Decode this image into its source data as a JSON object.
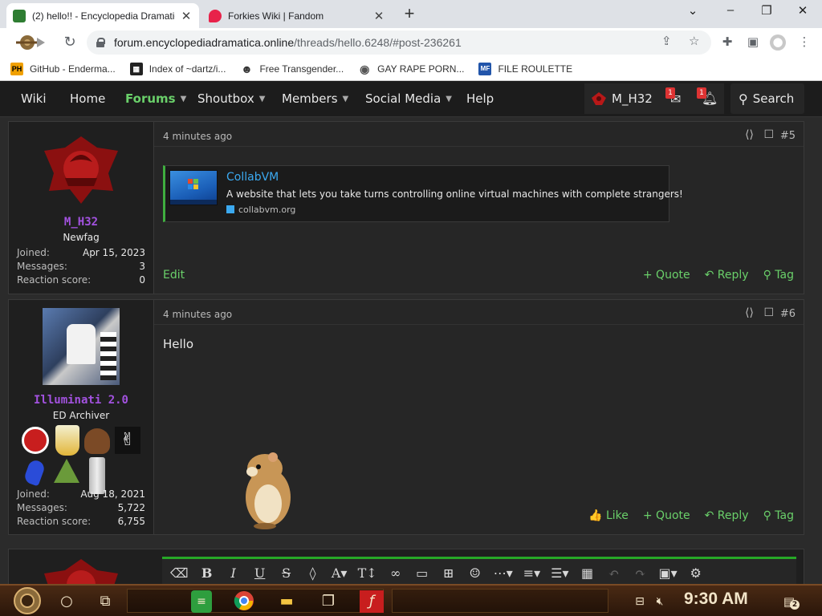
{
  "browser": {
    "tabs": [
      {
        "title": "(2) hello!! - Encyclopedia Dramatica",
        "close": "✕",
        "favicon_color": "#2e7d32"
      },
      {
        "title": "Forkies Wiki | Fandom",
        "close": "✕",
        "favicon_color": "#e8224a"
      }
    ],
    "new_tab": "+",
    "window_controls": {
      "minimize": "⌄",
      "restore": "–",
      "maximize": "❐",
      "close": "✕"
    },
    "nav": {
      "back": "←",
      "forward": "→",
      "reload": "↻"
    },
    "url_host": "forum.encyclopediadramatica.online",
    "url_path": "/threads/hello.6248/#post-236261",
    "bookmarks": [
      {
        "label": "GitHub - Enderma...",
        "icon": "PH",
        "icon_bg": "#f0a000"
      },
      {
        "label": "Index of ~dartz/i...",
        "icon": "▦",
        "icon_bg": "#222222"
      },
      {
        "label": "Free Transgender...",
        "icon": "☻",
        "icon_bg": "#555555"
      },
      {
        "label": "GAY RAPE PORN...",
        "icon": "◉",
        "icon_bg": "#666666"
      },
      {
        "label": "FILE ROULETTE",
        "icon": "MF",
        "icon_bg": "#2255aa"
      }
    ]
  },
  "forum_nav": {
    "items": [
      {
        "label": "Wiki",
        "dropdown": false
      },
      {
        "label": "Home",
        "dropdown": false
      },
      {
        "label": "Forums",
        "dropdown": true,
        "active": true
      },
      {
        "label": "Shoutbox",
        "dropdown": true
      },
      {
        "label": "Members",
        "dropdown": true
      },
      {
        "label": "Social Media",
        "dropdown": true
      },
      {
        "label": "Help",
        "dropdown": false
      }
    ],
    "user": "M_H32",
    "inbox_badge": "1",
    "alerts_badge": "1",
    "search_label": "Search"
  },
  "posts": [
    {
      "time": "4 minutes ago",
      "number": "#5",
      "username": "M_H32",
      "user_title": "Newfag",
      "stats": [
        {
          "label": "Joined:",
          "value": "Apr 15, 2023"
        },
        {
          "label": "Messages:",
          "value": "3"
        },
        {
          "label": "Reaction score:",
          "value": "0"
        }
      ],
      "embed": {
        "title": "CollabVM",
        "description": "A website that lets you take turns controlling online virtual machines with complete strangers!",
        "domain": "collabvm.org"
      },
      "edit_label": "Edit",
      "actions": [
        "+ Quote",
        "↶ Reply",
        "⚲ Tag"
      ]
    },
    {
      "time": "4 minutes ago",
      "number": "#6",
      "username": "Illuminati 2.0",
      "user_title": "ED Archiver",
      "stats": [
        {
          "label": "Joined:",
          "value": "Aug 18, 2021"
        },
        {
          "label": "Messages:",
          "value": "5,722"
        },
        {
          "label": "Reaction score:",
          "value": "6,755"
        }
      ],
      "body": "Hello",
      "actions": [
        "👍 Like",
        "+ Quote",
        "↶ Reply",
        "⚲ Tag"
      ]
    }
  ],
  "taskbar": {
    "time": "9:30 AM",
    "notification_count": "2"
  }
}
